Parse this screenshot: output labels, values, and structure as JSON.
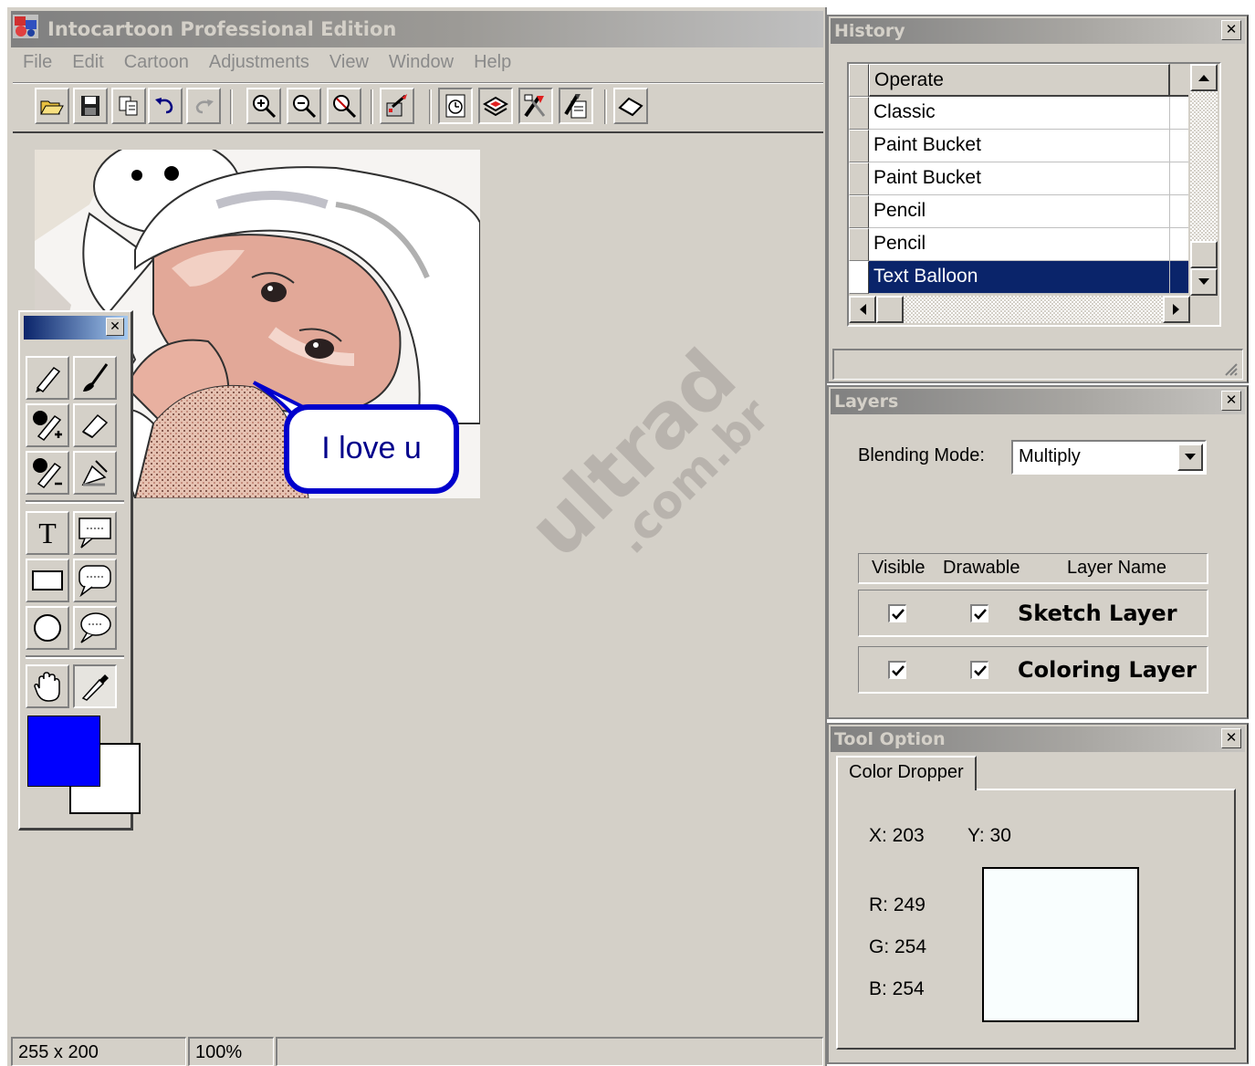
{
  "window": {
    "title": "Intocartoon Professional Edition"
  },
  "menu": [
    "File",
    "Edit",
    "Cartoon",
    "Adjustments",
    "View",
    "Window",
    "Help"
  ],
  "toolbar_icons": [
    "open-icon",
    "save-icon",
    "copy-icon",
    "undo-icon",
    "redo-icon",
    "zoom-in-icon",
    "zoom-out-icon",
    "zoom-fit-icon",
    "cartoon-icon",
    "history-icon",
    "layers-icon",
    "tools-icon",
    "options-icon",
    "eraser-icon"
  ],
  "canvas": {
    "balloon_text": "I love u"
  },
  "toolbox": {
    "tools": [
      "pencil-icon",
      "brush-icon",
      "add-magic-icon",
      "eraser-icon",
      "remove-magic-icon",
      "fill-icon",
      "text-icon",
      "balloon-rect-icon",
      "rectangle-icon",
      "balloon-round-icon",
      "ellipse-icon",
      "balloon-thought-icon",
      "hand-icon",
      "dropper-icon"
    ],
    "text_tool_label": "T",
    "foreground_color": "#0000ff",
    "background_color": "#ffffff"
  },
  "history": {
    "title": "History",
    "header": "Operate",
    "rows": [
      "Classic",
      "Paint Bucket",
      "Paint Bucket",
      "Pencil",
      "Pencil",
      "Text Balloon"
    ],
    "selected": "Text Balloon"
  },
  "layers": {
    "title": "Layers",
    "blending_label": "Blending Mode:",
    "blending_value": "Multiply",
    "columns": {
      "visible": "Visible",
      "drawable": "Drawable",
      "name": "Layer Name"
    },
    "rows": [
      {
        "name": "Sketch Layer",
        "visible": true,
        "drawable": true
      },
      {
        "name": "Coloring Layer",
        "visible": true,
        "drawable": true
      }
    ]
  },
  "tool_option": {
    "title": "Tool Option",
    "tab": "Color Dropper",
    "x": "X: 203",
    "y": "Y: 30",
    "r": "R: 249",
    "g": "G: 254",
    "b": "B: 254",
    "preview_color": "#f9fefe"
  },
  "status": {
    "size": "255 x 200",
    "zoom": "100%"
  },
  "watermark": {
    "main": "ultrad",
    "sub": ".com.br"
  }
}
